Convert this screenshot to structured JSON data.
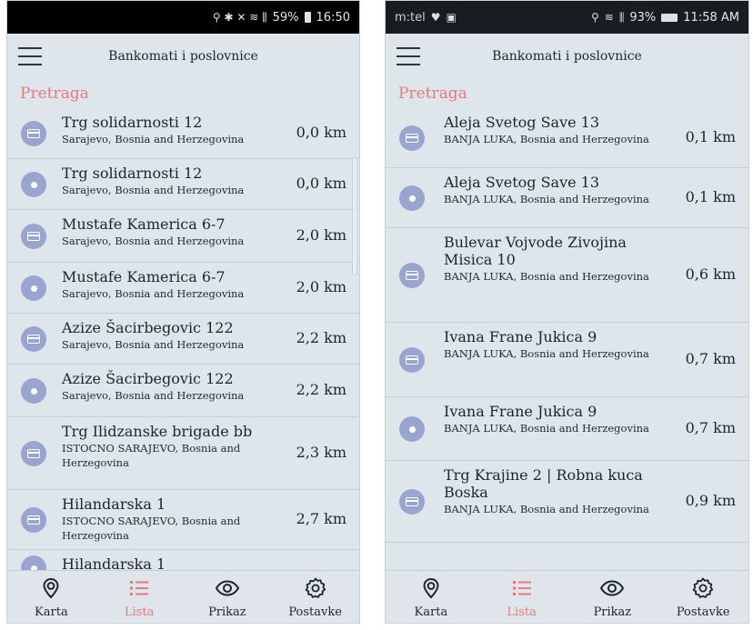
{
  "colors": {
    "background": "#dee5eb",
    "accent": "#e8797c",
    "badge": "#9aa5cf",
    "text": "#1d2430"
  },
  "left": {
    "status": {
      "icons": "⚲ ✱ ✕ ≋ ⫼",
      "battery": "59%",
      "time": "16:50"
    },
    "header_title": "Bankomati i poslovnice",
    "section_label": "Pretraga",
    "rows": [
      {
        "icon": "atm-card-icon",
        "street": "Trg solidarnosti 12",
        "city": "Sarajevo, Bosnia and Herzegovina",
        "distance": "0,0 km"
      },
      {
        "icon": "branch-dot-icon",
        "street": "Trg solidarnosti 12",
        "city": "Sarajevo, Bosnia and Herzegovina",
        "distance": "0,0 km"
      },
      {
        "icon": "atm-card-icon",
        "street": "Mustafe Kamerica 6-7",
        "city": "Sarajevo, Bosnia and Herzegovina",
        "distance": "2,0 km"
      },
      {
        "icon": "branch-dot-icon",
        "street": "Mustafe Kamerica 6-7",
        "city": "Sarajevo, Bosnia and Herzegovina",
        "distance": "2,0 km"
      },
      {
        "icon": "atm-card-icon",
        "street": "Azize Šacirbegovic 122",
        "city": "Sarajevo, Bosnia and Herzegovina",
        "distance": "2,2 km"
      },
      {
        "icon": "branch-dot-icon",
        "street": "Azize Šacirbegovic 122",
        "city": "Sarajevo, Bosnia and Herzegovina",
        "distance": "2,2 km"
      },
      {
        "icon": "atm-card-icon",
        "street": "Trg Ilidzanske brigade bb",
        "city": "ISTOCNO SARAJEVO, Bosnia and Herzegovina",
        "distance": "2,3 km"
      },
      {
        "icon": "atm-card-icon",
        "street": "Hilandarska 1",
        "city": "ISTOCNO SARAJEVO, Bosnia and Herzegovina",
        "distance": "2,7 km"
      },
      {
        "icon": "branch-dot-icon",
        "street": "Hilandarska 1",
        "city": "",
        "distance": ""
      }
    ]
  },
  "right": {
    "status": {
      "carrier": "m:tel",
      "battery": "93%",
      "time": "11:58 AM"
    },
    "header_title": "Bankomati i poslovnice",
    "section_label": "Pretraga",
    "rows": [
      {
        "icon": "atm-card-icon",
        "street": "Aleja Svetog Save 13",
        "city": "BANJA LUKA, Bosnia and Herzegovina",
        "distance": "0,1 km"
      },
      {
        "icon": "branch-dot-icon",
        "street": "Aleja Svetog Save 13",
        "city": "BANJA LUKA, Bosnia and Herzegovina",
        "distance": "0,1 km"
      },
      {
        "icon": "atm-card-icon",
        "street": "Bulevar Vojvode Zivojina Misica 10",
        "city": "BANJA LUKA, Bosnia and Herzegovina",
        "distance": "0,6 km"
      },
      {
        "icon": "atm-card-icon",
        "street": "Ivana Frane Jukica 9",
        "city": "BANJA LUKA, Bosnia and Herzegovina",
        "distance": "0,7 km"
      },
      {
        "icon": "branch-dot-icon",
        "street": "Ivana Frane Jukica 9",
        "city": "BANJA LUKA, Bosnia and Herzegovina",
        "distance": "0,7 km"
      },
      {
        "icon": "atm-card-icon",
        "street": "Trg Krajine 2 | Robna kuca Boska",
        "city": "BANJA LUKA, Bosnia and Herzegovina",
        "distance": "0,9 km"
      }
    ]
  },
  "nav": {
    "items": [
      {
        "label": "Karta",
        "icon": "map-pin-icon",
        "active": false
      },
      {
        "label": "Lista",
        "icon": "list-icon",
        "active": true
      },
      {
        "label": "Prikaz",
        "icon": "eye-icon",
        "active": false
      },
      {
        "label": "Postavke",
        "icon": "gear-icon",
        "active": false
      }
    ]
  }
}
